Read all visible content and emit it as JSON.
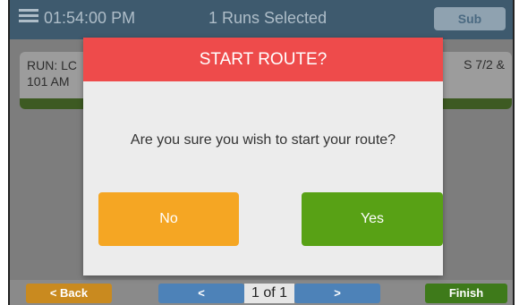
{
  "topbar": {
    "clock": "01:54:00 PM",
    "runs_selected": "1 Runs Selected",
    "sub_label": "Sub"
  },
  "run_card": {
    "left_line1": "RUN: LC",
    "left_line2": "101 AM",
    "right_text": "S 7/2 &"
  },
  "modal": {
    "title": "START ROUTE?",
    "message": "Are you sure you wish to start your route?",
    "no_label": "No",
    "yes_label": "Yes"
  },
  "bottombar": {
    "back_label": "< Back",
    "prev_label": "<",
    "page_indicator": "1 of 1",
    "next_label": ">",
    "finish_label": "Finish"
  },
  "colors": {
    "modal_header": "#ee4b4b",
    "no_button": "#f5a623",
    "yes_button": "#58a115",
    "nav_blue": "#4d82b8",
    "finish_green": "#3e7a1a"
  },
  "icons": {
    "menu": "hamburger-menu-icon"
  }
}
